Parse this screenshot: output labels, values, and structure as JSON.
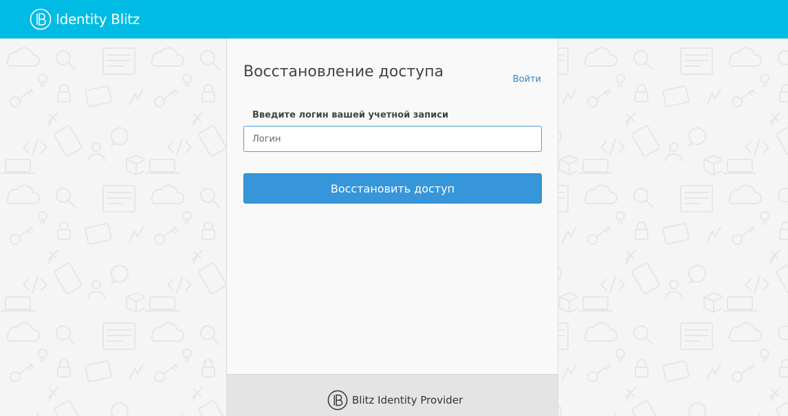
{
  "header": {
    "brand_name": "Identity Blitz",
    "background_color": "#00bce4",
    "logo_icon": "blitz-b-logo-icon"
  },
  "card": {
    "title": "Восстановление доступа",
    "login_link": "Войти",
    "field_label": "Введите логин вашей учетной записи",
    "login_input": {
      "placeholder": "Логин",
      "value": ""
    },
    "submit_label": "Восстановить доступ",
    "accent_color": "#3796da"
  },
  "footer": {
    "provider_name": "Blitz Identity Provider",
    "logo_icon": "blitz-b-logo-icon"
  },
  "background": {
    "pattern_icons": [
      "cloud-icon",
      "lock-icon",
      "key-icon",
      "magnifier-icon",
      "document-icon",
      "code-icon",
      "sms-icon",
      "users-icon",
      "laptop-icon",
      "box-icon",
      "pin-icon",
      "tablet-icon",
      "id-card-icon",
      "lightning-icon",
      "bulb-icon"
    ]
  }
}
